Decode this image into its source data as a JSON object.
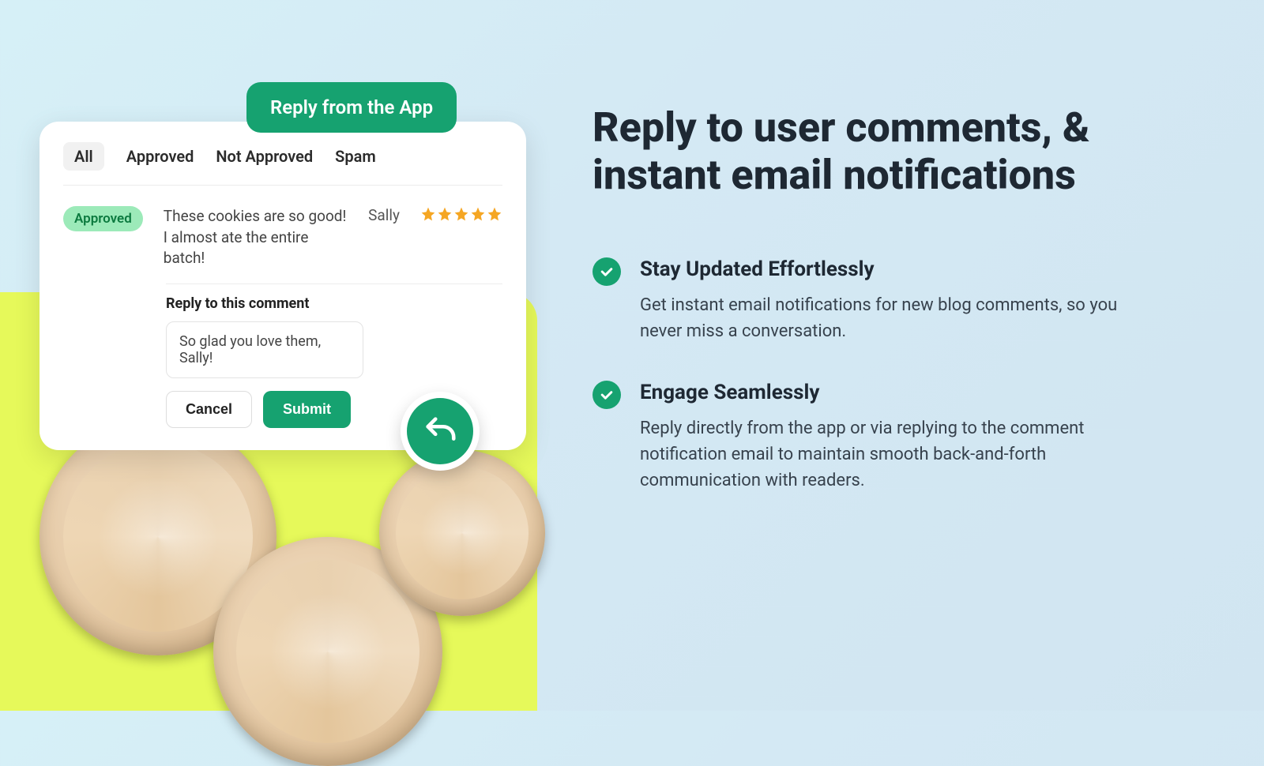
{
  "badge": {
    "label": "Reply from the App"
  },
  "tabs": [
    "All",
    "Approved",
    "Not Approved",
    "Spam"
  ],
  "active_tab": "All",
  "comment": {
    "status": "Approved",
    "text": "These cookies are so good! I almost ate the entire batch!",
    "author": "Sally",
    "rating": 5
  },
  "reply": {
    "title": "Reply to this comment",
    "draft": "So glad you love them, Sally!",
    "cancel": "Cancel",
    "submit": "Submit"
  },
  "right": {
    "headline": "Reply to user comments, & instant email notifications",
    "features": [
      {
        "title": "Stay Updated Effortlessly",
        "desc": "Get instant email notifications for new blog comments, so you never miss a conversation."
      },
      {
        "title": "Engage Seamlessly",
        "desc": "Reply directly from the app or via replying to the comment notification email to maintain smooth back-and-forth communication with readers."
      }
    ]
  },
  "colors": {
    "accent": "#16a270",
    "star": "#f5a623"
  }
}
